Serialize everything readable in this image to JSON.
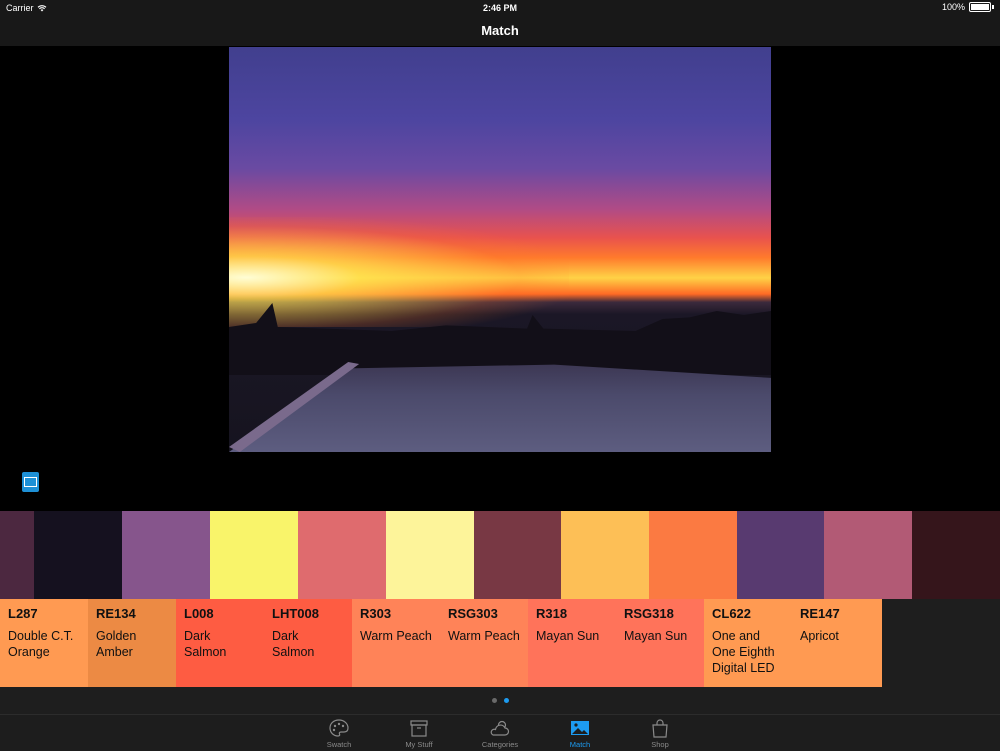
{
  "status": {
    "carrier": "Carrier",
    "time": "2:46 PM",
    "battery": "100%",
    "battery_level": 1.0
  },
  "nav": {
    "title": "Match"
  },
  "swatch_strip": [
    {
      "color": "#4c2840"
    },
    {
      "color": "#15111f"
    },
    {
      "color": "#86558c"
    },
    {
      "color": "#f9f46a"
    },
    {
      "color": "#df6b6e"
    },
    {
      "color": "#fdf49a"
    },
    {
      "color": "#783844"
    },
    {
      "color": "#fdbf56"
    },
    {
      "color": "#fb7a42"
    },
    {
      "color": "#583a70"
    },
    {
      "color": "#b25a75"
    },
    {
      "color": "#35151b"
    }
  ],
  "cards": [
    {
      "code": "L287",
      "name": "Double C.T. Orange",
      "color": "#ff9a52"
    },
    {
      "code": "RE134",
      "name": "Golden Amber",
      "color": "#ec8a44"
    },
    {
      "code": "L008",
      "name": "Dark Salmon",
      "color": "#fe5c42"
    },
    {
      "code": "LHT008",
      "name": "Dark Salmon",
      "color": "#fe5c42"
    },
    {
      "code": "R303",
      "name": "Warm Peach",
      "color": "#ff8358"
    },
    {
      "code": "RSG303",
      "name": "Warm Peach",
      "color": "#ff8358"
    },
    {
      "code": "R318",
      "name": "Mayan Sun",
      "color": "#ff735a"
    },
    {
      "code": "RSG318",
      "name": "Mayan Sun",
      "color": "#ff735a"
    },
    {
      "code": "CL622",
      "name": "One and One Eighth Digital LED",
      "color": "#ff9a52"
    },
    {
      "code": "RE147",
      "name": "Apricot",
      "color": "#ff9a52"
    }
  ],
  "pager": {
    "pages": 2,
    "active_index": 1
  },
  "tabs": [
    {
      "label": "Swatch",
      "icon": "palette-icon"
    },
    {
      "label": "My Stuff",
      "icon": "box-icon"
    },
    {
      "label": "Categories",
      "icon": "cloud-sun-icon"
    },
    {
      "label": "Match",
      "icon": "image-icon",
      "active": true
    },
    {
      "label": "Shop",
      "icon": "shopping-bag-icon"
    }
  ],
  "accent_color": "#1d9bf0"
}
